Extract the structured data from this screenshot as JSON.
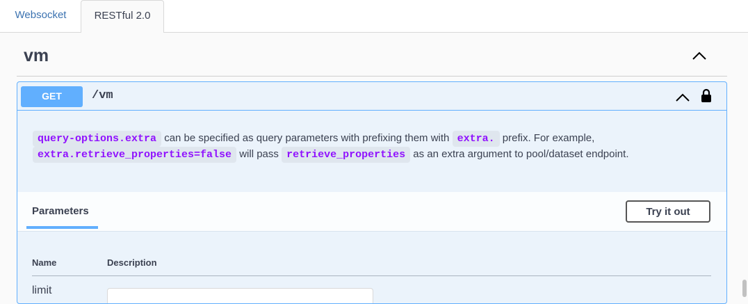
{
  "tabs": [
    {
      "label": "Websocket",
      "active": false
    },
    {
      "label": "RESTful 2.0",
      "active": true
    }
  ],
  "section": {
    "title": "vm"
  },
  "operation": {
    "method": "GET",
    "path": "/vm",
    "method_color": "#61affe",
    "description": {
      "code_query_options": "query-options.extra",
      "text_1": " can be specified as query parameters with prefixing them with ",
      "code_extra": "extra.",
      "text_2": " prefix. For example,",
      "code_example": "extra.retrieve_properties=false",
      "text_3": " will pass ",
      "code_retrieve": "retrieve_properties",
      "text_4": " as an extra argument to pool/dataset endpoint."
    }
  },
  "parameters": {
    "title": "Parameters",
    "try_button": "Try it out",
    "columns": {
      "name": "Name",
      "description": "Description"
    },
    "rows": [
      {
        "name": "limit",
        "value": ""
      }
    ]
  },
  "icons": {
    "section_toggle": "chevron-up-icon",
    "op_toggle": "chevron-up-icon",
    "auth": "lock-icon"
  }
}
